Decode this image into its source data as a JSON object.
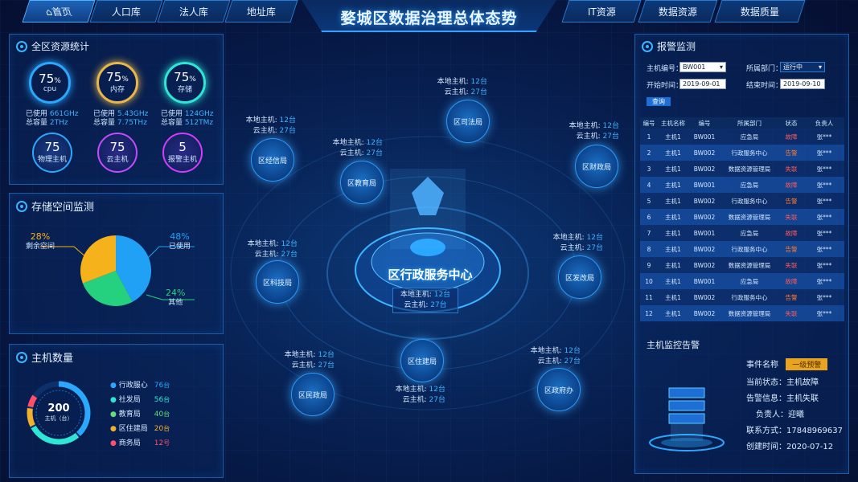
{
  "nav": {
    "home": "首页",
    "population": "人口库",
    "legal": "法人库",
    "address": "地址库",
    "it": "IT资源",
    "data": "数据资源",
    "quality": "数据质量"
  },
  "page_title": "婺城区数据治理总体态势",
  "resource_stats": {
    "title": "全区资源统计",
    "gauges": [
      {
        "value": "75",
        "unit": "%",
        "label": "cpu",
        "used_label": "已使用",
        "used": "661GHz",
        "total_label": "总容量",
        "total": "2THz",
        "color": "#2aa8ff"
      },
      {
        "value": "75",
        "unit": "%",
        "label": "内存",
        "used_label": "已使用",
        "used": "5.43GHz",
        "total_label": "总容量",
        "total": "7.75THz",
        "color": "#e8b64a"
      },
      {
        "value": "75",
        "unit": "%",
        "label": "存储",
        "used_label": "已使用",
        "used": "124GHz",
        "total_label": "总容量",
        "total": "512TMz",
        "color": "#2ee6d6"
      }
    ],
    "hosts": [
      {
        "value": "75",
        "label": "物理主机",
        "color": "#2aa8ff"
      },
      {
        "value": "75",
        "label": "云主机",
        "color": "#c24bff"
      },
      {
        "value": "5",
        "label": "报警主机",
        "color": "#d43bff"
      }
    ]
  },
  "storage": {
    "title": "存储空间监测",
    "remaining_pct": "28%",
    "remaining_label": "剩余空间",
    "used_pct": "48%",
    "used_label": "已使用",
    "other_pct": "24%",
    "other_label": "其他"
  },
  "host_count": {
    "title": "主机数量",
    "total": "200",
    "total_label": "主机（台）",
    "items": [
      {
        "name": "行政服心",
        "value": "76",
        "unit": "台",
        "color": "#2aa8ff"
      },
      {
        "name": "社发局",
        "value": "56",
        "unit": "台",
        "color": "#2ee6d6"
      },
      {
        "name": "教育局",
        "value": "40",
        "unit": "台",
        "color": "#5fe07a"
      },
      {
        "name": "区住建局",
        "value": "20",
        "unit": "台",
        "color": "#f1b12d"
      },
      {
        "name": "商务局",
        "value": "12",
        "unit": "号",
        "color": "#ff4f6a"
      }
    ]
  },
  "center": {
    "name": "区行政服务中心",
    "local_label": "本地主机:",
    "local": "12台",
    "cloud_label": "云主机:",
    "cloud": "27台"
  },
  "nodes": [
    {
      "name": "区司法局",
      "local": "12台",
      "cloud": "27台"
    },
    {
      "name": "区经信局",
      "local": "12台",
      "cloud": "27台"
    },
    {
      "name": "区教育局",
      "local": "12台",
      "cloud": "27台"
    },
    {
      "name": "区财政局",
      "local": "12台",
      "cloud": "27台"
    },
    {
      "name": "区科技局",
      "local": "12台",
      "cloud": "27台"
    },
    {
      "name": "区发改局",
      "local": "12台",
      "cloud": "27台"
    },
    {
      "name": "区住建局",
      "local": "12台",
      "cloud": "27台"
    },
    {
      "name": "区民政局",
      "local": "12台",
      "cloud": "27台"
    },
    {
      "name": "区政府办",
      "local": "12台",
      "cloud": "27台"
    }
  ],
  "node_local_label": "本地主机:",
  "node_cloud_label": "云主机:",
  "alarm": {
    "title": "报警监测",
    "host_label": "主机编号：",
    "host_value": "BW001",
    "dept_label": "所属部门：",
    "dept_value": "运行中",
    "start_label": "开始时间：",
    "start_value": "2019-09-01",
    "end_label": "结束时间：",
    "end_value": "2019-09-10",
    "query": "查询",
    "columns": [
      "编号",
      "主机名称",
      "编号",
      "所属部门",
      "状态",
      "负责人"
    ],
    "rows": [
      [
        "1",
        "主机1",
        "BW001",
        "应急局",
        "故障",
        "张***"
      ],
      [
        "2",
        "主机1",
        "BW002",
        "行政服务中心",
        "告警",
        "张***"
      ],
      [
        "3",
        "主机1",
        "BW002",
        "数据资源管理局",
        "失联",
        "张***"
      ],
      [
        "4",
        "主机1",
        "BW001",
        "应急局",
        "故障",
        "张***"
      ],
      [
        "5",
        "主机1",
        "BW002",
        "行政服务中心",
        "告警",
        "张***"
      ],
      [
        "6",
        "主机1",
        "BW002",
        "数据资源管理局",
        "失联",
        "张***"
      ],
      [
        "7",
        "主机1",
        "BW001",
        "应急局",
        "故障",
        "张***"
      ],
      [
        "8",
        "主机1",
        "BW002",
        "行政服务中心",
        "告警",
        "张***"
      ],
      [
        "9",
        "主机1",
        "BW002",
        "数据资源管理局",
        "失联",
        "张***"
      ],
      [
        "10",
        "主机1",
        "BW001",
        "应急局",
        "故障",
        "张***"
      ],
      [
        "11",
        "主机1",
        "BW002",
        "行政服务中心",
        "告警",
        "张***"
      ],
      [
        "12",
        "主机1",
        "BW002",
        "数据资源管理局",
        "失联",
        "张***"
      ]
    ]
  },
  "monitor": {
    "title": "主机监控告警",
    "event_label": "事件名称",
    "event_value": "一级预警",
    "state_label": "当前状态：",
    "state_value": "主机故障",
    "alarm_label": "告警信息：",
    "alarm_value": "主机失联",
    "owner_label": "负责人：",
    "owner_value": "迎曦",
    "phone_label": "联系方式：",
    "phone_value": "17848969637",
    "created_label": "创建时间：",
    "created_value": "2020-07-12"
  },
  "colors": {
    "fault": "#ff5a5a",
    "warn": "#ff7a2a",
    "lost": "#ff5a5a",
    "accent": "#3db4ff"
  }
}
